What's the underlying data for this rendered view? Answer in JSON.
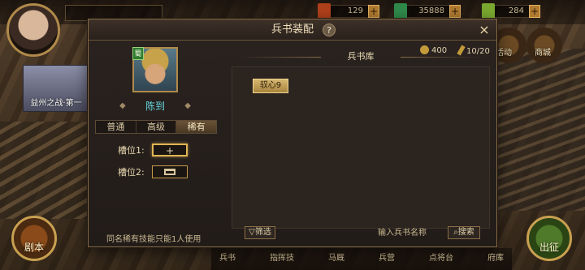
{
  "topbar": {
    "player_label": "",
    "resources": [
      {
        "icon": "red-token-icon",
        "value": "129",
        "color": "#b0401c"
      },
      {
        "icon": "jade-icon",
        "value": "35888",
        "color": "#2f8a4a"
      },
      {
        "icon": "green-ticket-icon",
        "value": "284",
        "color": "#7aa830"
      }
    ],
    "plus": "+"
  },
  "side": {
    "activity_label": "活动",
    "shop_label": "商城",
    "event_label": "益州之战·第一",
    "story_label": "剧本",
    "go_label": "出征"
  },
  "bottom_nav": [
    "兵书",
    "指挥技",
    "马厩",
    "兵营",
    "点将台",
    "府库"
  ],
  "dialog": {
    "title": "兵书装配",
    "help": "?",
    "close": "×",
    "hero": {
      "badge": "蜀",
      "name": "陈到"
    },
    "tabs": [
      {
        "label": "普通",
        "active": false
      },
      {
        "label": "高级",
        "active": false
      },
      {
        "label": "稀有",
        "active": true
      }
    ],
    "slots": [
      {
        "label": "槽位1:",
        "content": "+",
        "state": "empty"
      },
      {
        "label": "槽位2:",
        "content": "",
        "state": "locked"
      }
    ],
    "note": "同名稀有技能只能1人使用",
    "library": {
      "title": "兵书库",
      "coins": "400",
      "capacity": "10/20",
      "books": [
        "驭心9"
      ]
    },
    "filter_label": "筛选",
    "search_placeholder": "输入兵书名称",
    "search_label": "搜索"
  }
}
